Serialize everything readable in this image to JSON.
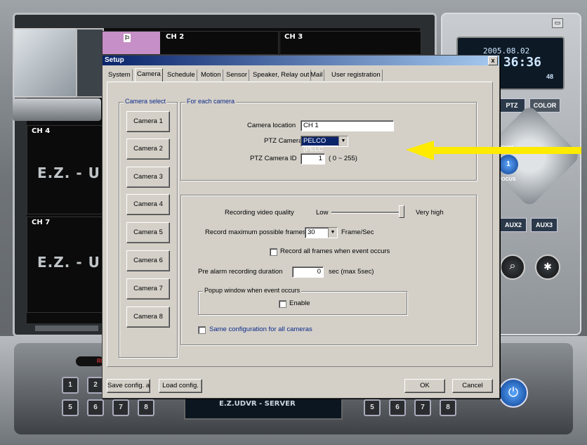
{
  "dvr": {
    "channels": {
      "ch2": "CH 2",
      "ch3": "CH 3",
      "ch4": "CH 4",
      "ch7": "CH 7"
    },
    "ez_text": "E.Z. - U",
    "clock_date": "2005.08.02",
    "clock_time": ":36:36",
    "clock_percent": "48",
    "ptz_tab": "PTZ",
    "color_tab": "COLOR",
    "zoom_label": "ZOOM",
    "focus_label": "FOCUS",
    "aux2": "AUX2",
    "aux3": "AUX3",
    "server_title": "E.Z.UDVR - SERVER",
    "rec_label": "RE",
    "num_buttons_left": [
      "1",
      "2",
      "5",
      "6",
      "7",
      "8"
    ],
    "num_buttons_right": [
      "5",
      "6",
      "7",
      "8"
    ]
  },
  "dialog": {
    "title": "Setup",
    "close": "x",
    "tabs": [
      "System",
      "Camera",
      "Schedule",
      "Motion",
      "Sensor",
      "Speaker, Relay out",
      "Mail",
      "User registration"
    ],
    "active_tab": "Camera",
    "camera_select_title": "Camera select",
    "camera_buttons": [
      "Camera 1",
      "Camera 2",
      "Camera 3",
      "Camera 4",
      "Camera 5",
      "Camera 6",
      "Camera 7",
      "Camera 8"
    ],
    "for_each_title": "For each camera",
    "camera_location_label": "Camera location",
    "camera_location_value": "CH 1",
    "ptz_camera_label": "PTZ Camera",
    "ptz_camera_value": "PELCO (PELC",
    "ptz_id_label": "PTZ Camera ID",
    "ptz_id_value": "1",
    "ptz_id_range": "( 0 ~ 255)",
    "quality_label": "Recording video quality",
    "quality_low": "Low",
    "quality_high": "Very high",
    "quality_level": 1.0,
    "max_frames_label": "Record maximum possible frames",
    "max_frames_value": "30",
    "frames_unit": "Frame/Sec",
    "record_all_label": "Record all frames when event occurs",
    "pre_alarm_label": "Pre alarm recording duration",
    "pre_alarm_value": "0",
    "pre_alarm_unit": "sec (max 5sec)",
    "popup_title": "Popup window when event occurs",
    "enable_label": "Enable",
    "same_config_label": "Same configuration for all cameras",
    "save_config": "Save config. a",
    "load_config": "Load config.",
    "ok": "OK",
    "cancel": "Cancel"
  },
  "colors": {
    "arrow": "#ffeb00",
    "title_blue": "#0a246a",
    "group_title": "#0b2a8a"
  }
}
